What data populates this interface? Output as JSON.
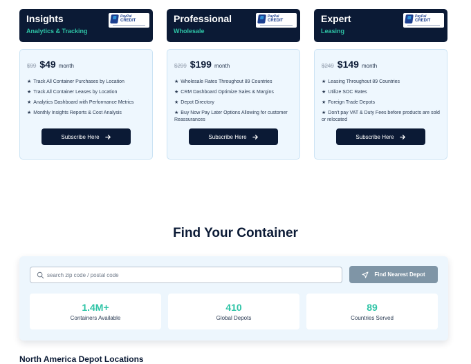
{
  "plans": [
    {
      "name": "Insights",
      "subtitle": "Analytics & Tracking",
      "badge": {
        "word": "PayPal",
        "credit": "CREDIT"
      },
      "old_price": "$99",
      "price": "$49",
      "period": "month",
      "features": [
        "Track All Container Purchases by Location",
        "Track All Container Leases by Location",
        "Analytics Dashboard with Performance Metrics",
        "Monthly Insights Reports & Cost Analysis"
      ],
      "button": "Subscribe Here"
    },
    {
      "name": "Professional",
      "subtitle": "Wholesale",
      "badge": {
        "word": "PayPal",
        "credit": "CREDIT"
      },
      "old_price": "$299",
      "price": "$199",
      "period": "month",
      "features": [
        "Wholesale Rates Throughout 89 Countries",
        "CRM Dashboard Optimize Sales & Margins",
        "Depot Directory",
        "Buy Now Pay Later Options Allowing for customer Reassurances"
      ],
      "button": "Subscribe Here"
    },
    {
      "name": "Expert",
      "subtitle": "Leasing",
      "badge": {
        "word": "PayPal",
        "credit": "CREDIT"
      },
      "old_price": "$249",
      "price": "$149",
      "period": "month",
      "features": [
        "Leasing Throughout 89 Countries",
        "Utilize SOC Rates",
        "Foreign Trade Depots",
        "Don't pay VAT & Duty Fees before products are sold or relocated"
      ],
      "button": "Subscribe Here"
    }
  ],
  "find": {
    "title": "Find Your Container",
    "search_placeholder": "search zip code / postal code",
    "button": "Find Nearest Depot",
    "stats": [
      {
        "value": "1.4M+",
        "label": "Containers Available"
      },
      {
        "value": "410",
        "label": "Global Depots"
      },
      {
        "value": "89",
        "label": "Countries Served"
      }
    ]
  },
  "depots": {
    "title": "North America Depot Locations"
  },
  "colors": {
    "navy": "#0b1a35",
    "teal": "#2ec4a6",
    "card_bg": "#eef7fe",
    "button_grey": "#7f95a6"
  },
  "icons": {
    "arrow": "arrow-right-icon",
    "search": "search-icon",
    "navigate": "navigation-arrow-icon",
    "paypal": "paypal-credit-logo"
  }
}
